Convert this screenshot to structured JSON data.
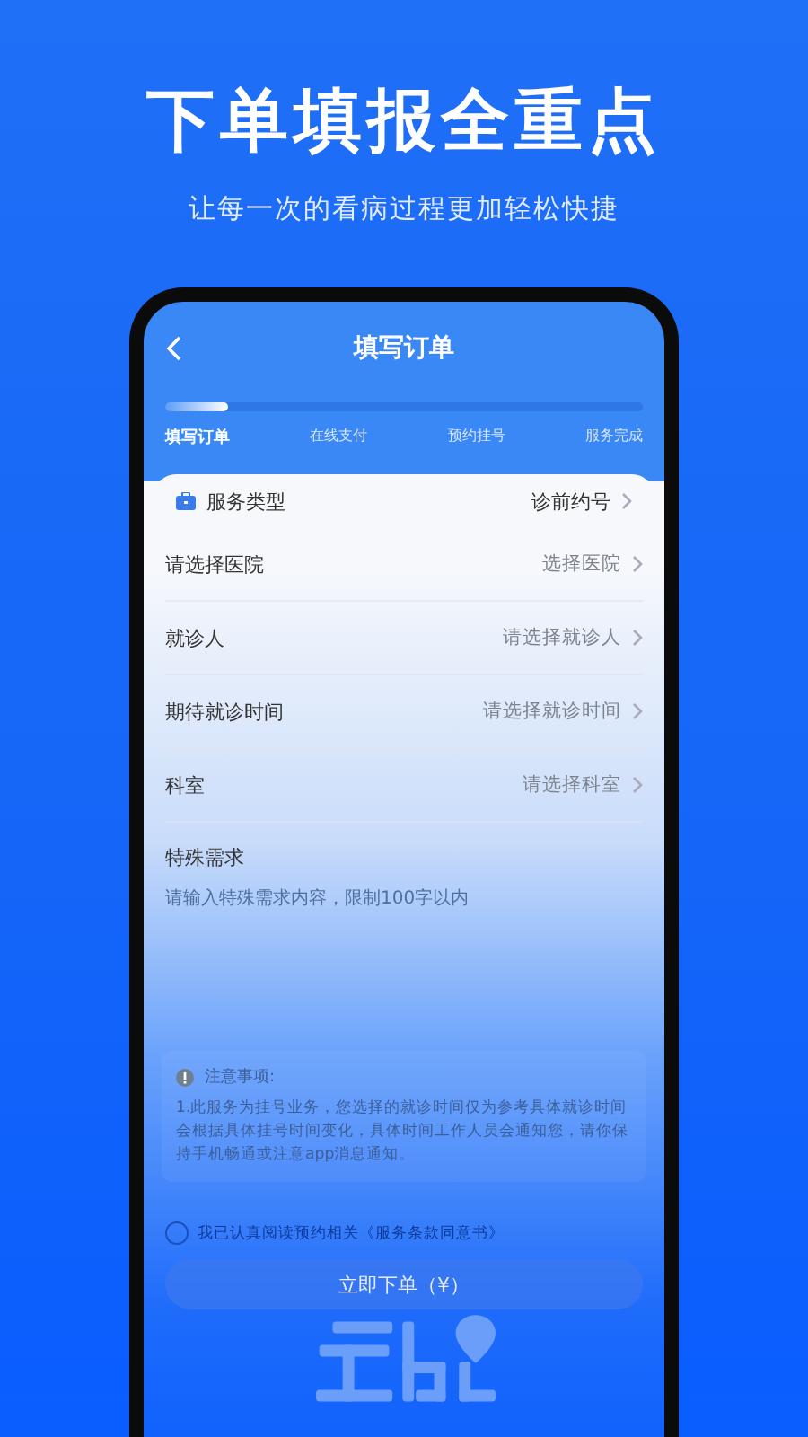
{
  "headline": "下单填报全重点",
  "subtitle": "让每一次的看病过程更加轻松快捷",
  "screen": {
    "title": "填写订单",
    "progress": {
      "level": 0.13
    },
    "steps": [
      {
        "label": "填写订单",
        "selected": true
      },
      {
        "label": "在线支付",
        "selected": false
      },
      {
        "label": "预约挂号",
        "selected": false
      },
      {
        "label": "服务完成",
        "selected": false
      }
    ],
    "service": {
      "label": "服务类型",
      "value": "诊前约号"
    },
    "fields": [
      {
        "label": "请选择医院",
        "placeholder": "选择医院"
      },
      {
        "label": "就诊人",
        "placeholder": "请选择就诊人"
      },
      {
        "label": "期待就诊时间",
        "placeholder": "请选择就诊时间"
      },
      {
        "label": "科室",
        "placeholder": "请选择科室"
      }
    ],
    "special": {
      "label": "特殊需求",
      "placeholder": "请输入特殊需求内容，限制100字以内"
    },
    "notice": {
      "title": "注意事项:",
      "body": "1.此服务为挂号业务，您选择的就诊时间仅为参考具体就诊时间会根据具体挂号时间变化，具体时间工作人员会通知您，请你保持手机畅通或注意app消息通知。"
    },
    "agreement": {
      "text": "我已认真阅读预约相关《服务条款同意书》",
      "checked": false
    },
    "submit": "立即下单（¥）"
  }
}
